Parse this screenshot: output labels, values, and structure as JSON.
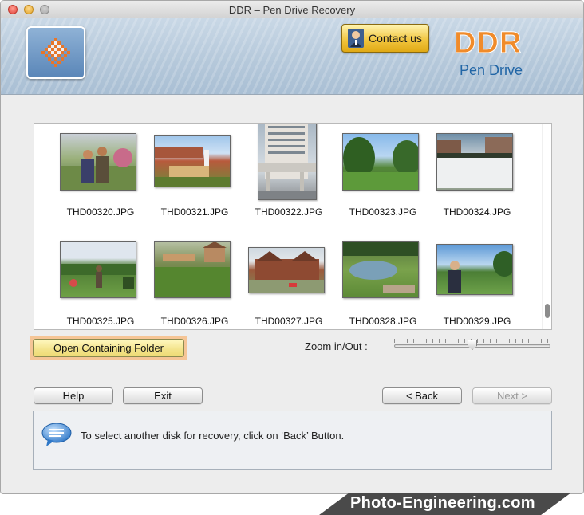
{
  "window": {
    "title": "DDR – Pen Drive Recovery"
  },
  "header": {
    "contact_label": "Contact us",
    "brand": "DDR",
    "product": "Pen Drive",
    "brand_color": "#f08b2a",
    "product_color": "#2266a6"
  },
  "thumbnails": [
    {
      "name": "THD00320.JPG"
    },
    {
      "name": "THD00321.JPG"
    },
    {
      "name": "THD00322.JPG"
    },
    {
      "name": "THD00323.JPG"
    },
    {
      "name": "THD00324.JPG"
    },
    {
      "name": "THD00325.JPG"
    },
    {
      "name": "THD00326.JPG"
    },
    {
      "name": "THD00327.JPG"
    },
    {
      "name": "THD00328.JPG"
    },
    {
      "name": "THD00329.JPG"
    }
  ],
  "actions": {
    "open_folder_label": "Open Containing Folder",
    "zoom_label": "Zoom in/Out :",
    "zoom_level": 0.5
  },
  "nav": {
    "help_label": "Help",
    "exit_label": "Exit",
    "back_label": "< Back",
    "next_label": "Next >"
  },
  "status": {
    "message": "To select another disk for recovery, click on ‘Back’ Button."
  },
  "watermark": {
    "text": "Photo-Engineering.com"
  }
}
